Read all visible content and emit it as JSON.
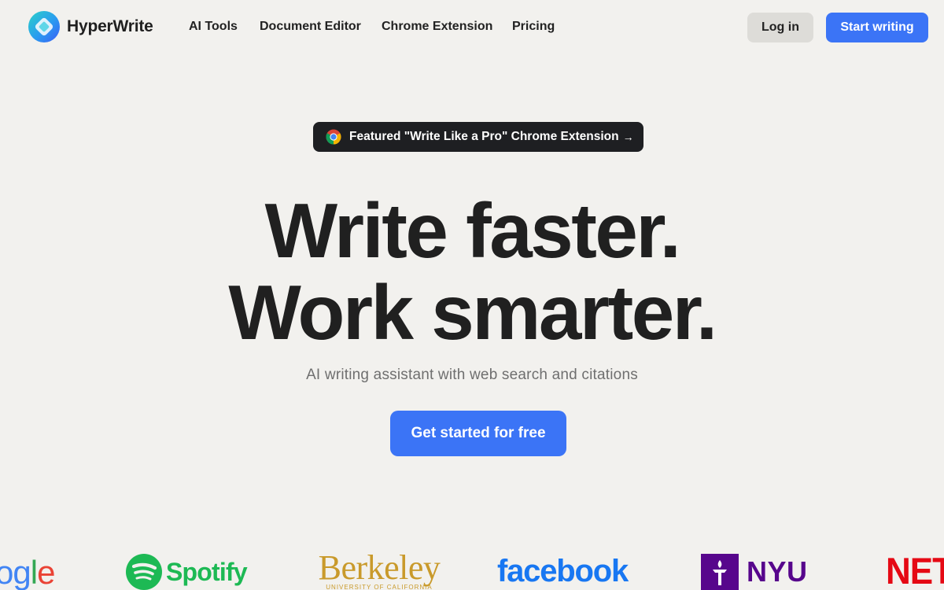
{
  "brand": {
    "name": "HyperWrite",
    "logo_icon": "hyperwrite-logo-icon"
  },
  "nav": {
    "items": [
      "AI Tools",
      "Document Editor",
      "Chrome Extension",
      "Pricing"
    ]
  },
  "header": {
    "login_label": "Log in",
    "start_label": "Start writing"
  },
  "featured": {
    "icon": "chrome-icon",
    "text": "Featured \"Write Like a Pro\" Chrome Extension",
    "arrow": "→"
  },
  "hero": {
    "line1": "Write faster.",
    "line2": "Work smarter.",
    "subtitle": "AI writing assistant with web search and citations",
    "cta_label": "Get started for free"
  },
  "logos": {
    "google": [
      "o",
      "g",
      "l",
      "e"
    ],
    "spotify": "Spotify",
    "berkeley": "Berkeley",
    "berkeley_sub": "UNIVERSITY OF CALIFORNIA",
    "facebook": "facebook",
    "nyu": "NYU",
    "netflix": "NETF"
  },
  "colors": {
    "accent": "#3b74f6",
    "background": "#f2f1ee",
    "google": [
      "#4285f4",
      "#4285f4",
      "#34a853",
      "#ea4335"
    ],
    "spotify": "#1db954",
    "berkeley": "#c99a2b",
    "facebook": "#1877f2",
    "nyu": "#57068c",
    "netflix": "#e50914"
  }
}
